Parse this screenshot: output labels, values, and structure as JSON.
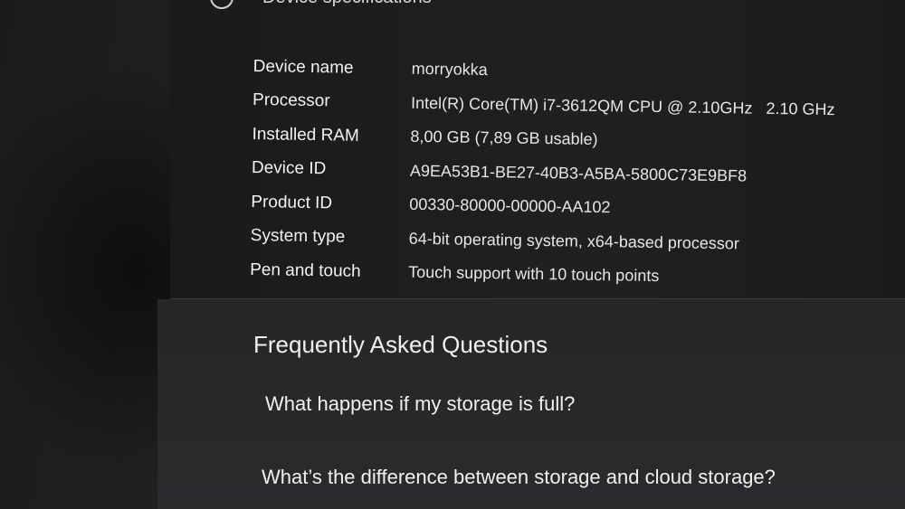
{
  "section": {
    "title": "Device specifications"
  },
  "specs": [
    {
      "label": "Device name",
      "value": "morryokka"
    },
    {
      "label": "Processor",
      "value": "Intel(R) Core(TM) i7-3612QM CPU @ 2.10GHz   2.10 GHz"
    },
    {
      "label": "Installed RAM",
      "value": "8,00 GB (7,89 GB usable)"
    },
    {
      "label": "Device ID",
      "value": "A9EA53B1-BE27-40B3-A5BA-5800C73E9BF8"
    },
    {
      "label": "Product ID",
      "value": "00330-80000-00000-AA102"
    },
    {
      "label": "System type",
      "value": "64-bit operating system, x64-based processor"
    },
    {
      "label": "Pen and touch",
      "value": "Touch support with 10 touch points"
    }
  ],
  "faq": {
    "title": "Frequently Asked Questions",
    "links": [
      "What happens if my storage is full?",
      "What’s the difference between storage and cloud storage?"
    ]
  }
}
